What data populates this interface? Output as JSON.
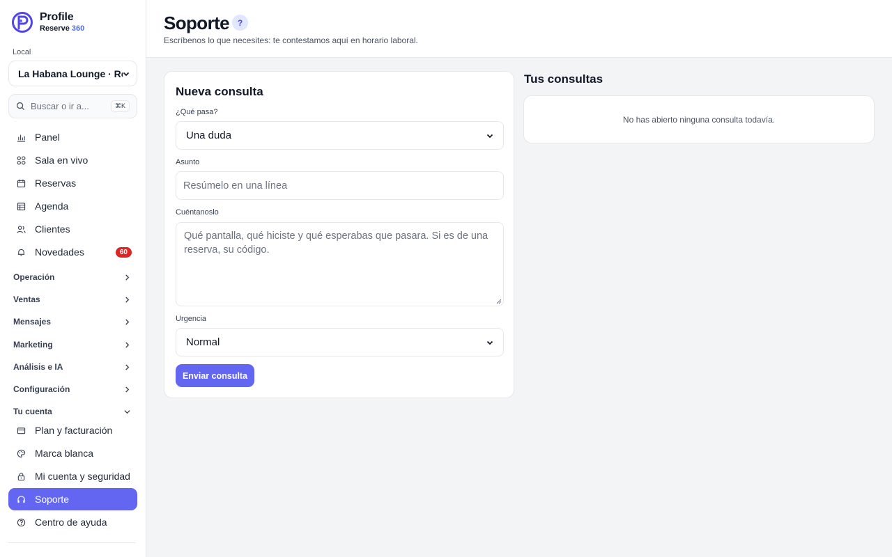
{
  "brand": {
    "name": "Profile",
    "sub_prefix": "Reserve",
    "sub_accent": "360"
  },
  "sidebar": {
    "local_label": "Local",
    "local_value": "La Habana Lounge · Rest",
    "search_placeholder": "Buscar o ir a...",
    "search_shortcut": "⌘K",
    "items": [
      {
        "label": "Panel",
        "icon": "bar-chart-icon"
      },
      {
        "label": "Sala en vivo",
        "icon": "grid-icon"
      },
      {
        "label": "Reservas",
        "icon": "calendar-icon"
      },
      {
        "label": "Agenda",
        "icon": "table-icon"
      },
      {
        "label": "Clientes",
        "icon": "users-icon"
      },
      {
        "label": "Novedades",
        "icon": "bell-icon",
        "badge": "60"
      }
    ],
    "groups": [
      "Operación",
      "Ventas",
      "Mensajes",
      "Marketing",
      "Análisis e IA",
      "Configuración",
      "Tu cuenta"
    ],
    "account_items": [
      {
        "label": "Plan y facturación",
        "icon": "credit-card-icon"
      },
      {
        "label": "Marca blanca",
        "icon": "palette-icon"
      },
      {
        "label": "Mi cuenta y seguridad",
        "icon": "lock-icon"
      },
      {
        "label": "Soporte",
        "icon": "headset-icon",
        "active": true
      },
      {
        "label": "Centro de ayuda",
        "icon": "help-circle-icon"
      }
    ]
  },
  "header": {
    "title": "Soporte",
    "help": "?",
    "subtitle": "Escríbenos lo que necesites: te contestamos aquí en horario laboral."
  },
  "form": {
    "title": "Nueva consulta",
    "type_label": "¿Qué pasa?",
    "type_value": "Una duda",
    "subject_label": "Asunto",
    "subject_placeholder": "Resúmelo en una línea",
    "body_label": "Cuéntanoslo",
    "body_placeholder": "Qué pantalla, qué hiciste y qué esperabas que pasara. Si es de una reserva, su código.",
    "urgency_label": "Urgencia",
    "urgency_value": "Normal",
    "submit_label": "Enviar consulta"
  },
  "tickets": {
    "title": "Tus consultas",
    "empty_text": "No has abierto ninguna consulta todavía."
  },
  "colors": {
    "accent": "#6366f1",
    "badge": "#dc2626"
  }
}
